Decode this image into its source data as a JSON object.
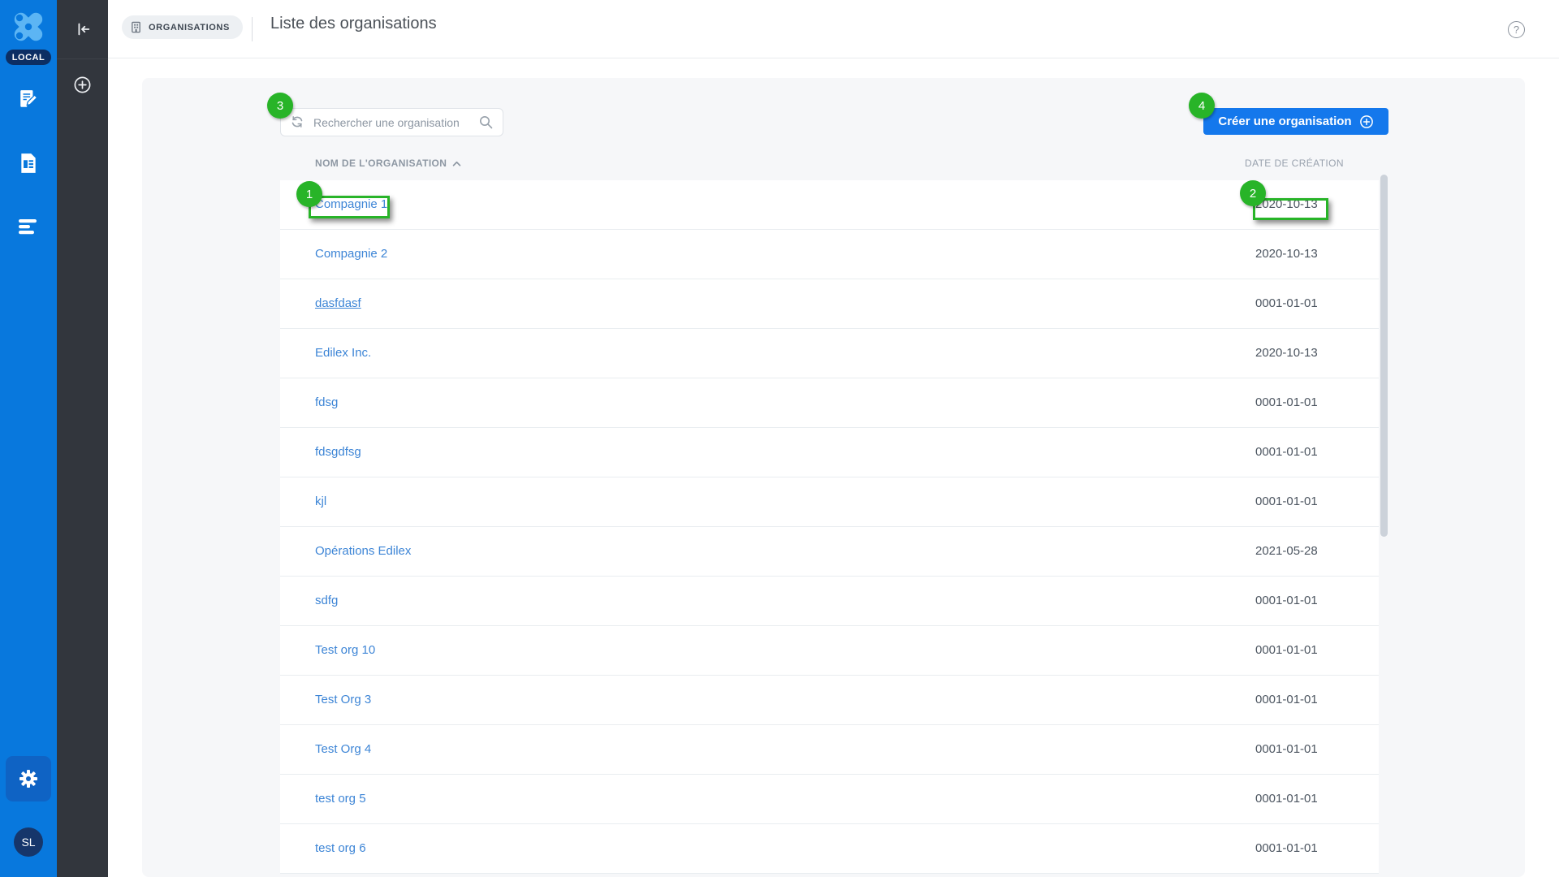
{
  "app": {
    "local_badge": "LOCAL",
    "avatar_initials": "SL",
    "help_glyph": "?"
  },
  "header": {
    "breadcrumb": "ORGANISATIONS",
    "title": "Liste des organisations"
  },
  "toolbar": {
    "search_placeholder": "Rechercher une organisation",
    "create_button_label": "Créer une organisation"
  },
  "table": {
    "columns": {
      "name": "NOM DE L'ORGANISATION",
      "date": "DATE DE CRÉATION"
    },
    "sort": {
      "column": "name",
      "direction": "asc"
    },
    "rows": [
      {
        "name": "Compagnie 1",
        "date": "2020-10-13"
      },
      {
        "name": "Compagnie 2",
        "date": "2020-10-13"
      },
      {
        "name": "dasfdasf",
        "date": "0001-01-01"
      },
      {
        "name": "Edilex Inc.",
        "date": "2020-10-13"
      },
      {
        "name": "fdsg",
        "date": "0001-01-01"
      },
      {
        "name": "fdsgdfsg",
        "date": "0001-01-01"
      },
      {
        "name": "kjl",
        "date": "0001-01-01"
      },
      {
        "name": "Opérations Edilex",
        "date": "2021-05-28"
      },
      {
        "name": "sdfg",
        "date": "0001-01-01"
      },
      {
        "name": "Test org 10",
        "date": "0001-01-01"
      },
      {
        "name": "Test Org 3",
        "date": "0001-01-01"
      },
      {
        "name": "Test Org 4",
        "date": "0001-01-01"
      },
      {
        "name": "test org 5",
        "date": "0001-01-01"
      },
      {
        "name": "test org 6",
        "date": "0001-01-01"
      }
    ]
  },
  "annotations": {
    "color": "#28b428",
    "markers": [
      {
        "label": "1",
        "target": "Compagnie 1 link"
      },
      {
        "label": "2",
        "target": "2020-10-13 date cell"
      },
      {
        "label": "3",
        "target": "search input"
      },
      {
        "label": "4",
        "target": "create organisation button"
      }
    ]
  },
  "colors": {
    "rail_blue": "#0878dd",
    "rail_dark": "#32363d",
    "button_blue": "#1478ec",
    "link_blue": "#3d85d6",
    "annotation_green": "#28b428",
    "card_bg": "#f6f7f9",
    "local_badge_bg": "#0c2e63"
  }
}
